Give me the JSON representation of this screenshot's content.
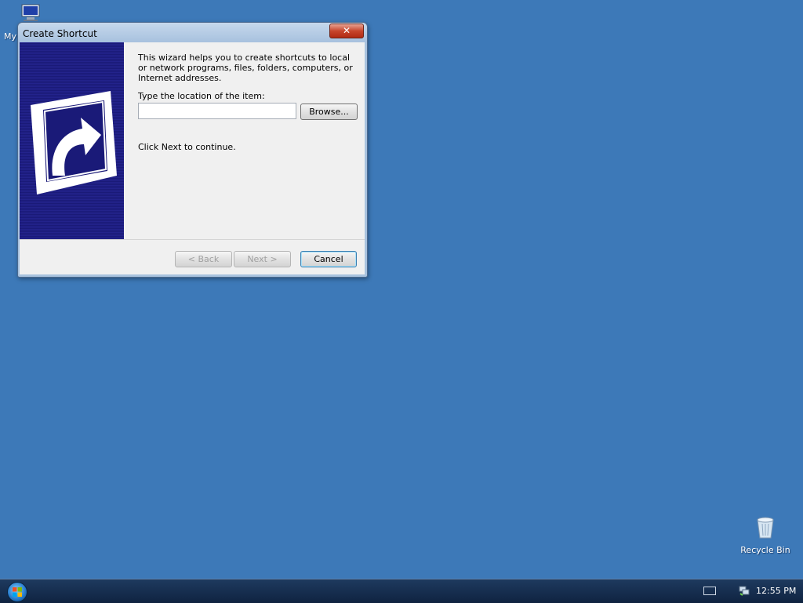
{
  "desktop": {
    "icons": [
      {
        "label": "My",
        "icon": "my-computer-icon"
      },
      {
        "label": "Recycle Bin",
        "icon": "recycle-bin-icon"
      }
    ]
  },
  "dialog": {
    "title": "Create Shortcut",
    "close_label": "✕",
    "intro_text": "This wizard helps you to create shortcuts to local or network programs, files, folders, computers, or Internet addresses.",
    "location_label": "Type the location of the item:",
    "location_value": "",
    "browse_label": "Browse...",
    "continue_text": "Click Next to continue.",
    "back_label": "< Back",
    "next_label": "Next >",
    "cancel_label": "Cancel"
  },
  "taskbar": {
    "clock": "12:55 PM"
  },
  "colors": {
    "desktop": "#3d79b8",
    "banner": "#23238c",
    "taskbar": "#16304f"
  }
}
